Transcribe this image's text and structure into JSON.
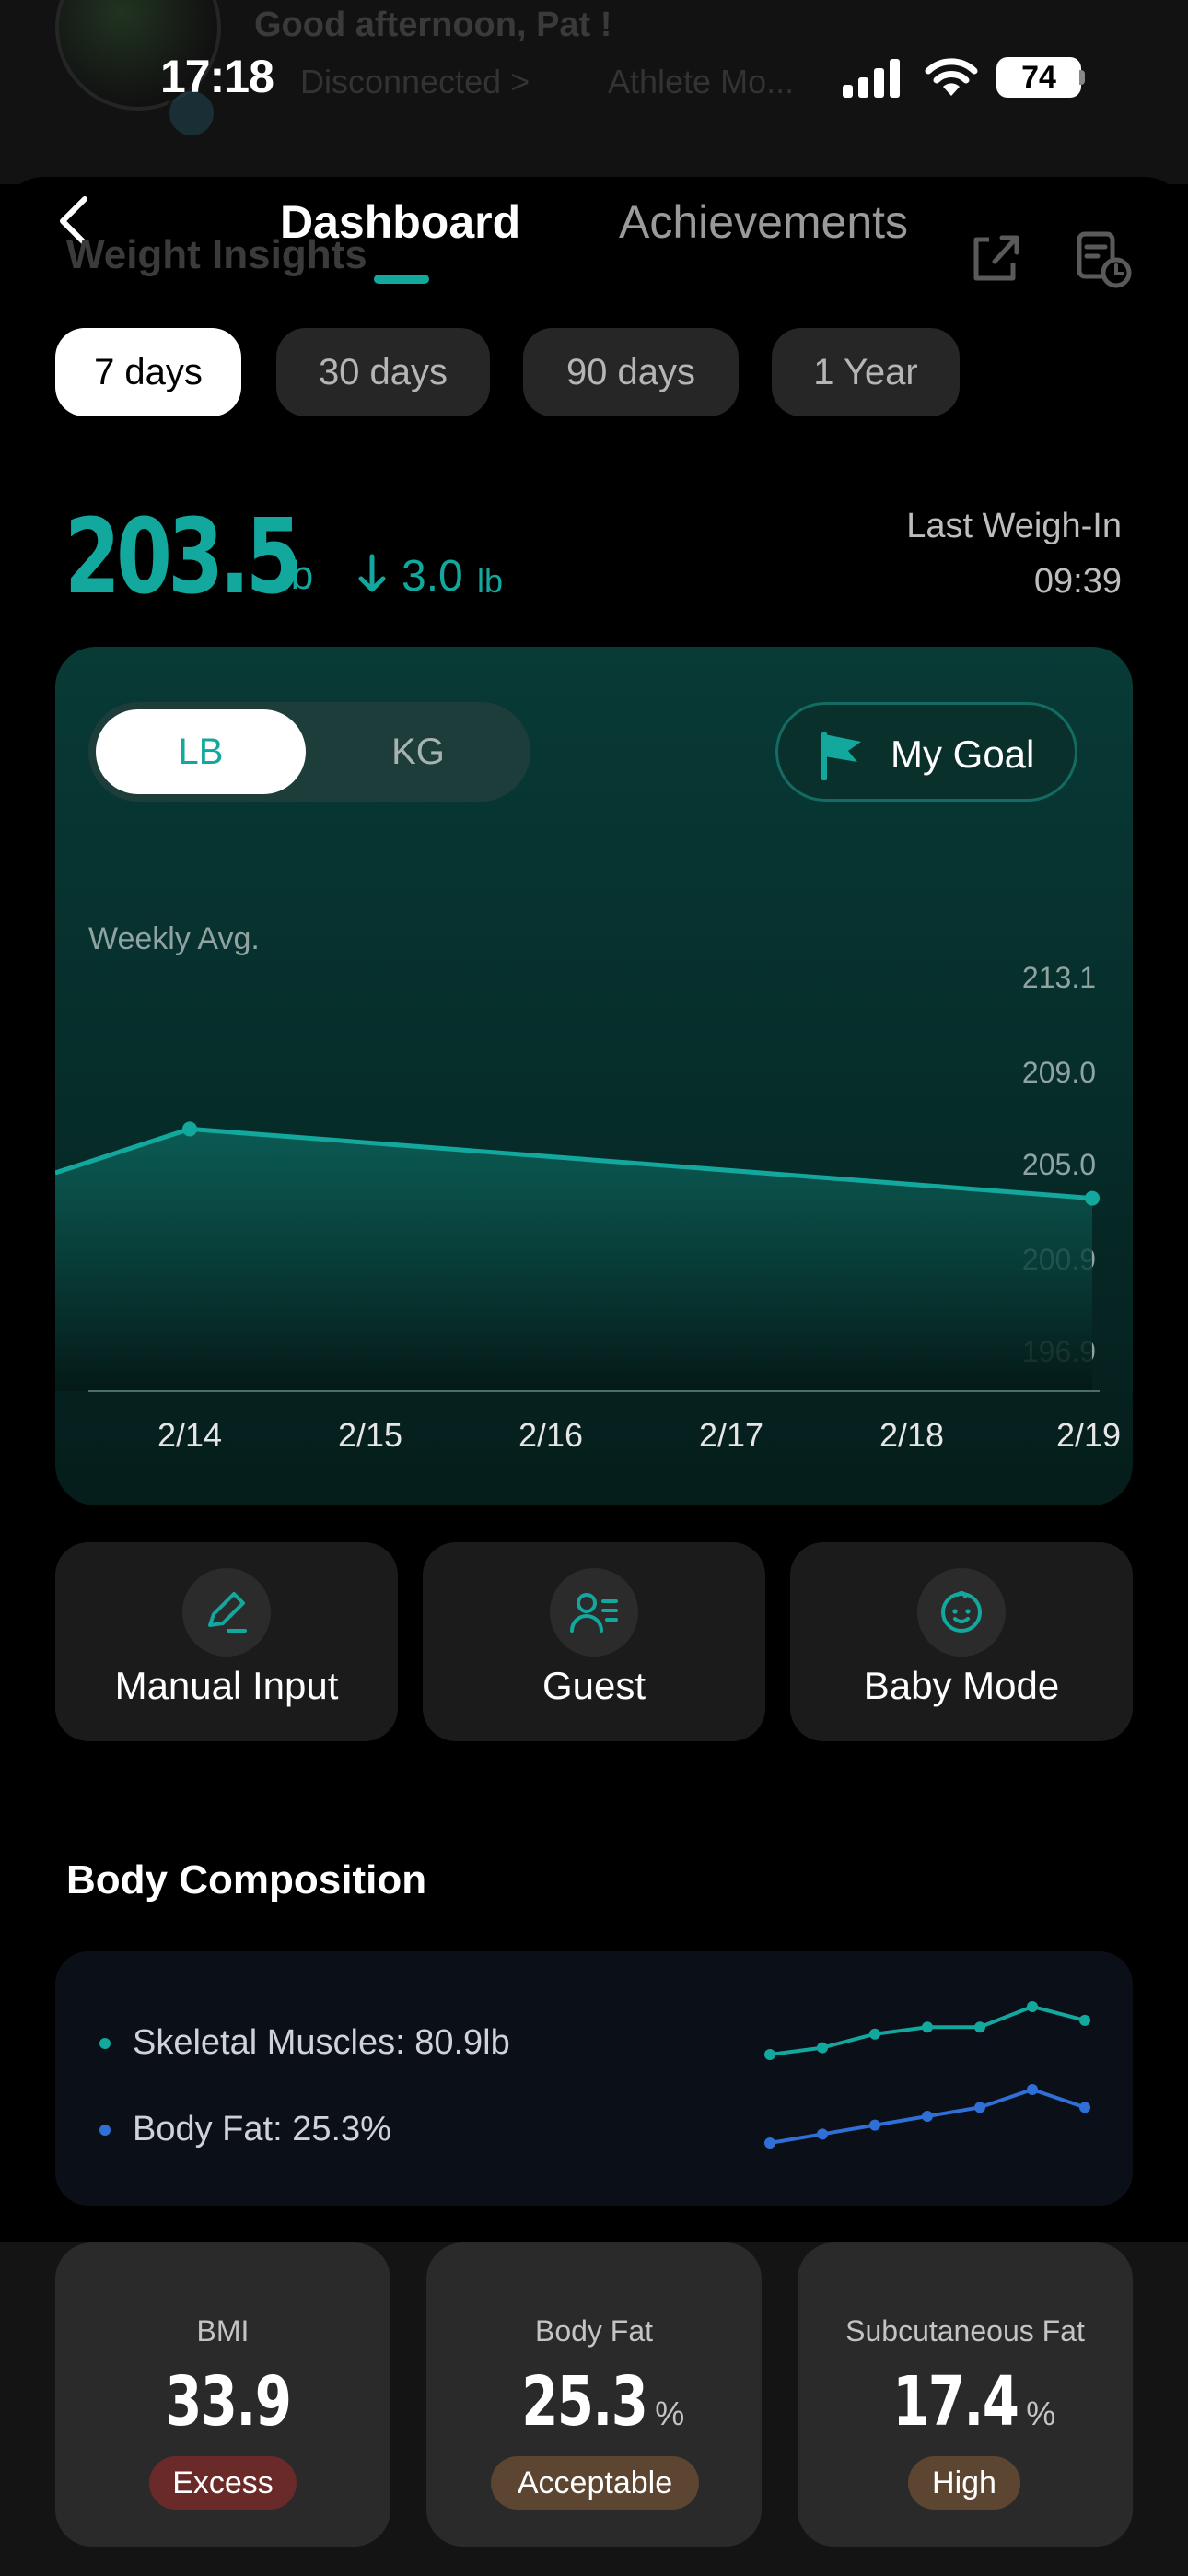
{
  "status_bar": {
    "time": "17:18",
    "battery": "74"
  },
  "background": {
    "greeting": "Good afternoon, Pat !",
    "connection": "Disconnected >",
    "mode": "Athlete Mo..."
  },
  "header": {
    "ghost_title": "Weight Insights",
    "tabs": [
      "Dashboard",
      "Achievements"
    ],
    "active_tab": "Dashboard"
  },
  "periods": [
    "7 days",
    "30 days",
    "90 days",
    "1 Year"
  ],
  "active_period": "7 days",
  "summary": {
    "weight": "203.5",
    "unit": "lb",
    "delta": "3.0",
    "delta_unit": "lb",
    "last_label": "Last Weigh-In",
    "last_time": "09:39"
  },
  "chart_controls": {
    "unit_lb": "LB",
    "unit_kg": "KG",
    "goal": "My Goal"
  },
  "chart_data": {
    "type": "area",
    "title": "",
    "series_label": "Weekly Avg.",
    "categories": [
      "2/14",
      "2/15",
      "2/16",
      "2/17",
      "2/18",
      "2/19"
    ],
    "y_ticks": [
      "213.1",
      "209.0",
      "205.0",
      "200.9",
      "196.9"
    ],
    "ylim": [
      196.9,
      213.1
    ],
    "series": [
      {
        "values": [
          206.5,
          205.8,
          205.1,
          204.4,
          203.9,
          203.5
        ]
      }
    ],
    "line_start_y": 204.6,
    "colors": {
      "line": "#13a89e"
    }
  },
  "actions": [
    {
      "label": "Manual Input",
      "icon": "pencil-icon"
    },
    {
      "label": "Guest",
      "icon": "guest-icon"
    },
    {
      "label": "Baby Mode",
      "icon": "baby-face-icon"
    }
  ],
  "body_composition": {
    "title": "Body Composition",
    "items": [
      {
        "label": "Skeletal Muscles: 80.9lb",
        "color": "#13a89e",
        "trend": [
          80.2,
          80.3,
          80.5,
          80.6,
          80.6,
          80.9,
          80.7
        ]
      },
      {
        "label": "Body Fat: 25.3%",
        "color": "#2f6fd6",
        "trend": [
          24.9,
          25.0,
          25.1,
          25.2,
          25.3,
          25.5,
          25.3
        ]
      }
    ]
  },
  "metrics": [
    {
      "title": "BMI",
      "value": "33.9",
      "unit": "",
      "badge": "Excess",
      "badge_color": "#6b2a2a"
    },
    {
      "title": "Body Fat",
      "value": "25.3",
      "unit": "%",
      "badge": "Acceptable",
      "badge_color": "#5c4632"
    },
    {
      "title": "Subcutaneous Fat",
      "value": "17.4",
      "unit": "%",
      "badge": "High",
      "badge_color": "#5c4632"
    }
  ]
}
